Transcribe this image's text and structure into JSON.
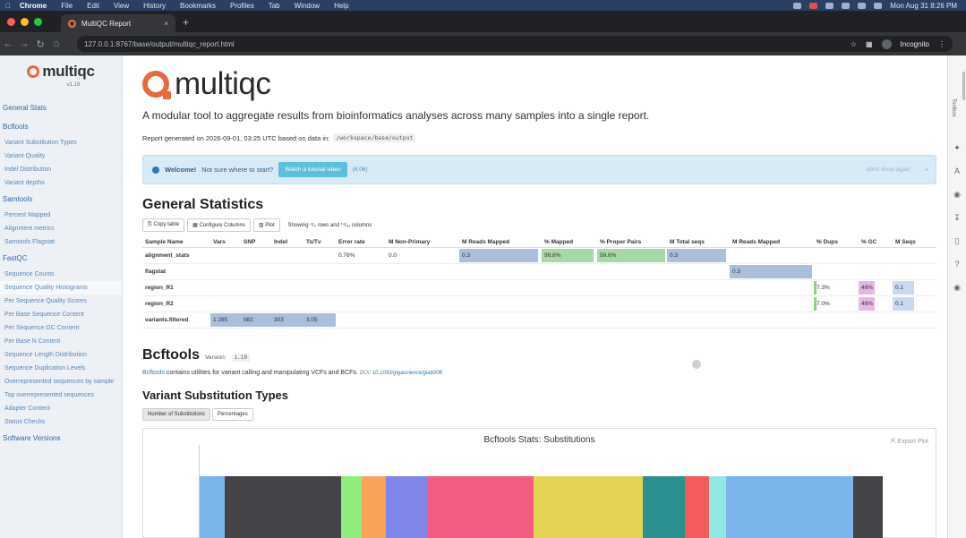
{
  "menubar": {
    "app": "Chrome",
    "items": [
      "File",
      "Edit",
      "View",
      "History",
      "Bookmarks",
      "Profiles",
      "Tab",
      "Window",
      "Help"
    ],
    "clock": "Mon Aug 31  8:26 PM"
  },
  "browser": {
    "tab_title": "MultiQC Report",
    "url": "127.0.0.1:8767/base/output/multiqc_report.html",
    "profile": "Incognito"
  },
  "sidebar": {
    "logo_text": "multiqc",
    "version": "v1.19",
    "items": [
      {
        "type": "section",
        "label": "General Stats"
      },
      {
        "type": "section",
        "label": "Bcftools"
      },
      {
        "type": "item",
        "label": "Variant Substitution Types"
      },
      {
        "type": "item",
        "label": "Variant Quality"
      },
      {
        "type": "item",
        "label": "Indel Distribution"
      },
      {
        "type": "item",
        "label": "Variant depths"
      },
      {
        "type": "section",
        "label": "Samtools"
      },
      {
        "type": "item",
        "label": "Percent Mapped"
      },
      {
        "type": "item",
        "label": "Alignment metrics"
      },
      {
        "type": "item",
        "label": "Samtools Flagstat"
      },
      {
        "type": "section",
        "label": "FastQC"
      },
      {
        "type": "item",
        "label": "Sequence Counts"
      },
      {
        "type": "item",
        "label": "Sequence Quality Histograms"
      },
      {
        "type": "item",
        "label": "Per Sequence Quality Scores"
      },
      {
        "type": "item",
        "label": "Per Base Sequence Content"
      },
      {
        "type": "item",
        "label": "Per Sequence GC Content"
      },
      {
        "type": "item",
        "label": "Per Base N Content"
      },
      {
        "type": "item",
        "label": "Sequence Length Distribution"
      },
      {
        "type": "item",
        "label": "Sequence Duplication Levels"
      },
      {
        "type": "item",
        "label": "Overrepresented sequences by sample"
      },
      {
        "type": "item",
        "label": "Top overrepresented sequences"
      },
      {
        "type": "item",
        "label": "Adapter Content"
      },
      {
        "type": "item",
        "label": "Status Checks"
      },
      {
        "type": "section",
        "label": "Software Versions"
      }
    ]
  },
  "header": {
    "logo_text": "multiqc",
    "tagline": "A modular tool to aggregate results from bioinformatics analyses across many samples into a single report.",
    "generated": "Report generated on 2026-09-01, 03:25 UTC based on data in:",
    "data_dir": "/workspace/base/output"
  },
  "welcome": {
    "title": "Welcome!",
    "text": "Not sure where to start?",
    "button": "Watch a tutorial video",
    "duration": "(6:06)",
    "dont_show": "don't show again",
    "close": "×"
  },
  "general_stats": {
    "title": "General Statistics",
    "buttons": [
      "Copy table",
      "Configure Columns",
      "Plot"
    ],
    "showing": "Showing ⁴/₄ rows and ¹⁴/₂₁ columns",
    "columns": [
      "Sample Name",
      "Vars",
      "SNP",
      "Indel",
      "Ts/Tv",
      "Error rate",
      "M Non-Primary",
      "M Reads Mapped",
      "% Mapped",
      "% Proper Pairs",
      "M Total seqs",
      "M Reads Mapped",
      "% Dups",
      "% GC",
      "M Seqs"
    ],
    "rows": [
      {
        "name": "alignment_stats",
        "cells": {
          "error_rate": "0.76%",
          "non_primary": "0.0",
          "reads_mapped": "0.3",
          "mapped": "99.8%",
          "proper_pairs": "99.6%",
          "total_seqs": "0.3"
        }
      },
      {
        "name": "flagstat",
        "cells": {
          "reads_mapped2": "0.3"
        }
      },
      {
        "name": "region_R1",
        "cells": {
          "dups": "7.3%",
          "gc": "48%",
          "seqs": "0.1"
        }
      },
      {
        "name": "region_R2",
        "cells": {
          "dups": "7.0%",
          "gc": "48%",
          "seqs": "0.1"
        }
      },
      {
        "name": "variants.filtered",
        "cells": {
          "vars": "1 285",
          "snp": "982",
          "indel": "303",
          "tstv": "3.05"
        }
      }
    ]
  },
  "bcftools": {
    "title": "Bcftools",
    "version_label": "Version:",
    "version": "1.19",
    "link": "Bcftools",
    "desc": "contains utilities for variant calling and manipulating VCFs and BCFs.",
    "doi_label": "DOI:",
    "doi": "10.1093/gigascience/giab008",
    "vst_title": "Variant Substitution Types",
    "tabs": [
      "Number of Substitutions",
      "Percentages"
    ]
  },
  "plot": {
    "title": "Bcftools Stats: Substitutions",
    "export": "Export Plot"
  },
  "chart_data": {
    "type": "bar",
    "title": "Bcftools Stats: Substitutions",
    "stacked": true,
    "orientation": "horizontal",
    "visible_segments": [
      {
        "color": "#7cb5ec",
        "fraction": 0.037
      },
      {
        "color": "#434348",
        "fraction": 0.17
      },
      {
        "color": "#90ed7d",
        "fraction": 0.03
      },
      {
        "color": "#f7a35c",
        "fraction": 0.035
      },
      {
        "color": "#8085e9",
        "fraction": 0.06
      },
      {
        "color": "#f15c80",
        "fraction": 0.155
      },
      {
        "color": "#e4d354",
        "fraction": 0.16
      },
      {
        "color": "#2b908f",
        "fraction": 0.062
      },
      {
        "color": "#f45b5b",
        "fraction": 0.035
      },
      {
        "color": "#91e8e1",
        "fraction": 0.025
      },
      {
        "color": "#7cb5ec",
        "fraction": 0.185
      },
      {
        "color": "#434348",
        "fraction": 0.043
      }
    ]
  },
  "toolbox": {
    "label": "Toolbox"
  }
}
